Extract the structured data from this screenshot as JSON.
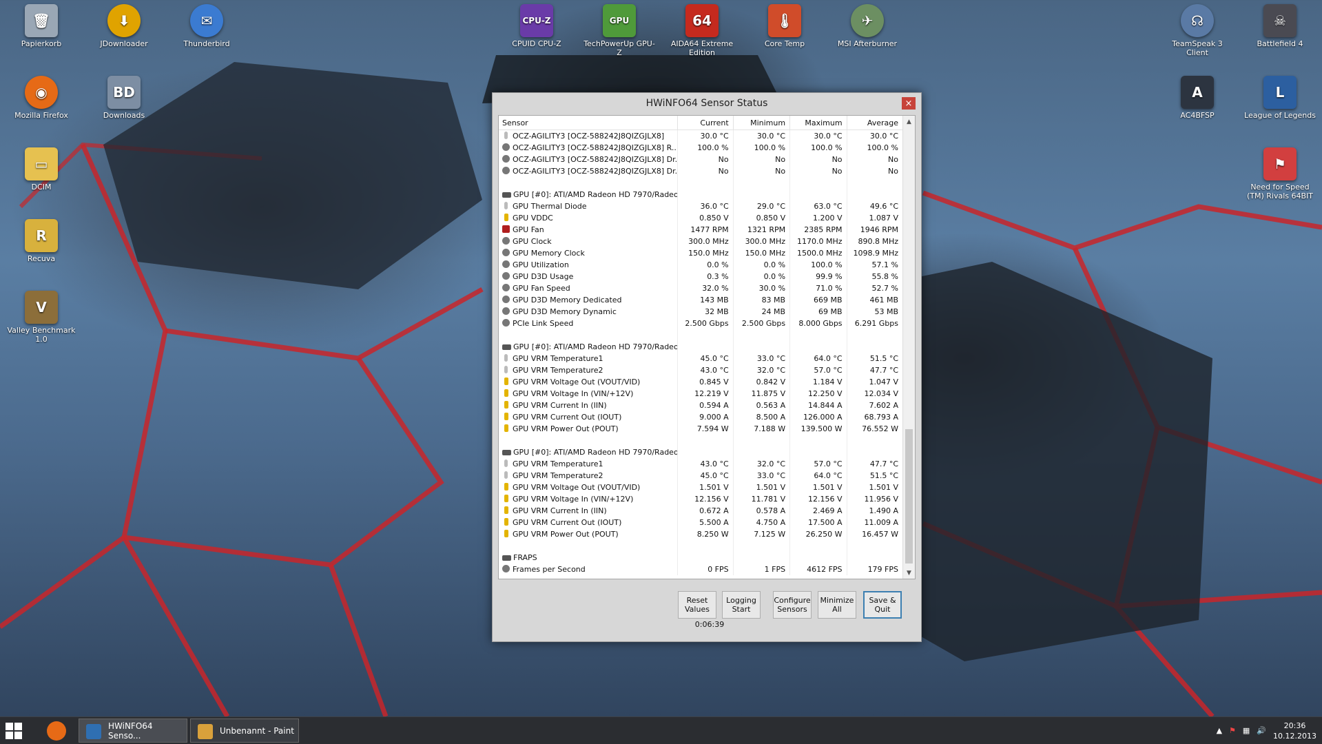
{
  "desktop_icons": [
    {
      "id": "recycle",
      "label": "Papierkorb",
      "icon": "trash-icon",
      "color": "#9aa7b5"
    },
    {
      "id": "jdownloader",
      "label": "JDownloader",
      "icon": "jdownloader-icon",
      "color": "#e0a300"
    },
    {
      "id": "thunderbird",
      "label": "Thunderbird",
      "icon": "thunderbird-icon",
      "color": "#3b7bd1"
    },
    {
      "id": "firefox",
      "label": "Mozilla Firefox",
      "icon": "firefox-icon",
      "color": "#e66a16"
    },
    {
      "id": "downloads",
      "label": "Downloads",
      "icon": "disc-icon",
      "color": "#7d8ea3"
    },
    {
      "id": "dcim",
      "label": "DCIM",
      "icon": "folder-icon",
      "color": "#e6c150"
    },
    {
      "id": "recuva",
      "label": "Recuva",
      "icon": "recuva-icon",
      "color": "#d8b13d"
    },
    {
      "id": "valley",
      "label": "Valley Benchmark 1.0",
      "icon": "valley-icon",
      "color": "#8c6e3a"
    },
    {
      "id": "cpuz",
      "label": "CPUID CPU-Z",
      "icon": "cpuz-icon",
      "color": "#6a3ba8"
    },
    {
      "id": "gpuz",
      "label": "TechPowerUp GPU-Z",
      "icon": "gpuz-icon",
      "color": "#4f9a3a"
    },
    {
      "id": "aida",
      "label": "AIDA64 Extreme Edition",
      "icon": "aida-icon",
      "color": "#c52a1e"
    },
    {
      "id": "coretemp",
      "label": "Core Temp",
      "icon": "thermometer-icon",
      "color": "#d04c2a"
    },
    {
      "id": "afterburner",
      "label": "MSI Afterburner",
      "icon": "afterburner-icon",
      "color": "#6c8f62"
    },
    {
      "id": "teamspeak",
      "label": "TeamSpeak 3 Client",
      "icon": "teamspeak-icon",
      "color": "#5a7aa5"
    },
    {
      "id": "bf4",
      "label": "Battlefield 4",
      "icon": "bf4-icon",
      "color": "#4a4a52"
    },
    {
      "id": "ac4",
      "label": "AC4BFSP",
      "icon": "ac4-icon",
      "color": "#2c3440"
    },
    {
      "id": "lol",
      "label": "League of Legends",
      "icon": "lol-icon",
      "color": "#2c5fa0"
    },
    {
      "id": "nfs",
      "label": "Need for Speed (TM) Rivals 64BIT",
      "icon": "nfs-icon",
      "color": "#d23f3f"
    }
  ],
  "window": {
    "title": "HWiNFO64 Sensor Status",
    "columns": [
      "Sensor",
      "Current",
      "Minimum",
      "Maximum",
      "Average"
    ],
    "rows": [
      {
        "icon": "therm",
        "name": "OCZ-AGILITY3 [OCZ-588242J8QIZGJLX8]",
        "vals": [
          "30.0 °C",
          "30.0 °C",
          "30.0 °C",
          "30.0 °C"
        ]
      },
      {
        "icon": "gauge",
        "name": "OCZ-AGILITY3 [OCZ-588242J8QIZGJLX8] R...",
        "vals": [
          "100.0 %",
          "100.0 %",
          "100.0 %",
          "100.0 %"
        ]
      },
      {
        "icon": "gauge",
        "name": "OCZ-AGILITY3 [OCZ-588242J8QIZGJLX8] Dr...",
        "vals": [
          "No",
          "No",
          "No",
          "No"
        ]
      },
      {
        "icon": "gauge",
        "name": "OCZ-AGILITY3 [OCZ-588242J8QIZGJLX8] Dr...",
        "vals": [
          "No",
          "No",
          "No",
          "No"
        ]
      },
      {
        "blank": true
      },
      {
        "icon": "chip",
        "name": "GPU [#0]: ATI/AMD Radeon HD 7970/Radeo...",
        "header": true
      },
      {
        "icon": "therm",
        "name": "GPU Thermal Diode",
        "vals": [
          "36.0 °C",
          "29.0 °C",
          "63.0 °C",
          "49.6 °C"
        ]
      },
      {
        "icon": "volt",
        "name": "GPU VDDC",
        "vals": [
          "0.850 V",
          "0.850 V",
          "1.200 V",
          "1.087 V"
        ]
      },
      {
        "icon": "fan",
        "name": "GPU Fan",
        "vals": [
          "1477 RPM",
          "1321 RPM",
          "2385 RPM",
          "1946 RPM"
        ]
      },
      {
        "icon": "gauge",
        "name": "GPU Clock",
        "vals": [
          "300.0 MHz",
          "300.0 MHz",
          "1170.0 MHz",
          "890.8 MHz"
        ]
      },
      {
        "icon": "gauge",
        "name": "GPU Memory Clock",
        "vals": [
          "150.0 MHz",
          "150.0 MHz",
          "1500.0 MHz",
          "1098.9 MHz"
        ]
      },
      {
        "icon": "gauge",
        "name": "GPU Utilization",
        "vals": [
          "0.0 %",
          "0.0 %",
          "100.0 %",
          "57.1 %"
        ]
      },
      {
        "icon": "gauge",
        "name": "GPU D3D Usage",
        "vals": [
          "0.3 %",
          "0.0 %",
          "99.9 %",
          "55.8 %"
        ]
      },
      {
        "icon": "gauge",
        "name": "GPU Fan Speed",
        "vals": [
          "32.0 %",
          "30.0 %",
          "71.0 %",
          "52.7 %"
        ]
      },
      {
        "icon": "gauge",
        "name": "GPU D3D Memory Dedicated",
        "vals": [
          "143 MB",
          "83 MB",
          "669 MB",
          "461 MB"
        ]
      },
      {
        "icon": "gauge",
        "name": "GPU D3D Memory Dynamic",
        "vals": [
          "32 MB",
          "24 MB",
          "69 MB",
          "53 MB"
        ]
      },
      {
        "icon": "gauge",
        "name": "PCIe Link Speed",
        "vals": [
          "2.500 Gbps",
          "2.500 Gbps",
          "8.000 Gbps",
          "6.291 Gbps"
        ]
      },
      {
        "blank": true
      },
      {
        "icon": "chip",
        "name": "GPU [#0]: ATI/AMD Radeon HD 7970/Radeo...",
        "header": true
      },
      {
        "icon": "therm",
        "name": "GPU VRM Temperature1",
        "vals": [
          "45.0 °C",
          "33.0 °C",
          "64.0 °C",
          "51.5 °C"
        ]
      },
      {
        "icon": "therm",
        "name": "GPU VRM Temperature2",
        "vals": [
          "43.0 °C",
          "32.0 °C",
          "57.0 °C",
          "47.7 °C"
        ]
      },
      {
        "icon": "volt",
        "name": "GPU VRM Voltage Out (VOUT/VID)",
        "vals": [
          "0.845 V",
          "0.842 V",
          "1.184 V",
          "1.047 V"
        ]
      },
      {
        "icon": "volt",
        "name": "GPU VRM Voltage In (VIN/+12V)",
        "vals": [
          "12.219 V",
          "11.875 V",
          "12.250 V",
          "12.034 V"
        ]
      },
      {
        "icon": "volt",
        "name": "GPU VRM Current In (IIN)",
        "vals": [
          "0.594 A",
          "0.563 A",
          "14.844 A",
          "7.602 A"
        ]
      },
      {
        "icon": "volt",
        "name": "GPU VRM Current Out (IOUT)",
        "vals": [
          "9.000 A",
          "8.500 A",
          "126.000 A",
          "68.793 A"
        ]
      },
      {
        "icon": "volt",
        "name": "GPU VRM Power Out (POUT)",
        "vals": [
          "7.594 W",
          "7.188 W",
          "139.500 W",
          "76.552 W"
        ]
      },
      {
        "blank": true
      },
      {
        "icon": "chip",
        "name": "GPU [#0]: ATI/AMD Radeon HD 7970/Radeo...",
        "header": true
      },
      {
        "icon": "therm",
        "name": "GPU VRM Temperature1",
        "vals": [
          "43.0 °C",
          "32.0 °C",
          "57.0 °C",
          "47.7 °C"
        ]
      },
      {
        "icon": "therm",
        "name": "GPU VRM Temperature2",
        "vals": [
          "45.0 °C",
          "33.0 °C",
          "64.0 °C",
          "51.5 °C"
        ]
      },
      {
        "icon": "volt",
        "name": "GPU VRM Voltage Out (VOUT/VID)",
        "vals": [
          "1.501 V",
          "1.501 V",
          "1.501 V",
          "1.501 V"
        ]
      },
      {
        "icon": "volt",
        "name": "GPU VRM Voltage In (VIN/+12V)",
        "vals": [
          "12.156 V",
          "11.781 V",
          "12.156 V",
          "11.956 V"
        ]
      },
      {
        "icon": "volt",
        "name": "GPU VRM Current In (IIN)",
        "vals": [
          "0.672 A",
          "0.578 A",
          "2.469 A",
          "1.490 A"
        ]
      },
      {
        "icon": "volt",
        "name": "GPU VRM Current Out (IOUT)",
        "vals": [
          "5.500 A",
          "4.750 A",
          "17.500 A",
          "11.009 A"
        ]
      },
      {
        "icon": "volt",
        "name": "GPU VRM Power Out (POUT)",
        "vals": [
          "8.250 W",
          "7.125 W",
          "26.250 W",
          "16.457 W"
        ]
      },
      {
        "blank": true
      },
      {
        "icon": "chip",
        "name": "FRAPS",
        "header": true
      },
      {
        "icon": "gauge",
        "name": "Frames per Second",
        "vals": [
          "0 FPS",
          "1 FPS",
          "4612 FPS",
          "179 FPS"
        ]
      }
    ],
    "buttons": {
      "reset": "Reset Values",
      "logging": "Logging Start",
      "configure": "Configure Sensors",
      "minimize": "Minimize All",
      "save": "Save & Quit"
    },
    "timer": "0:06:39",
    "close_label": "×"
  },
  "taskbar": {
    "tasks": [
      {
        "label": "HWiNFO64 Senso...",
        "icon": "hwinfo-icon",
        "color": "#2f6fb2"
      },
      {
        "label": "Unbenannt - Paint",
        "icon": "paint-icon",
        "color": "#d9a13b"
      }
    ],
    "clock_time": "20:36",
    "clock_date": "10.12.2013"
  }
}
